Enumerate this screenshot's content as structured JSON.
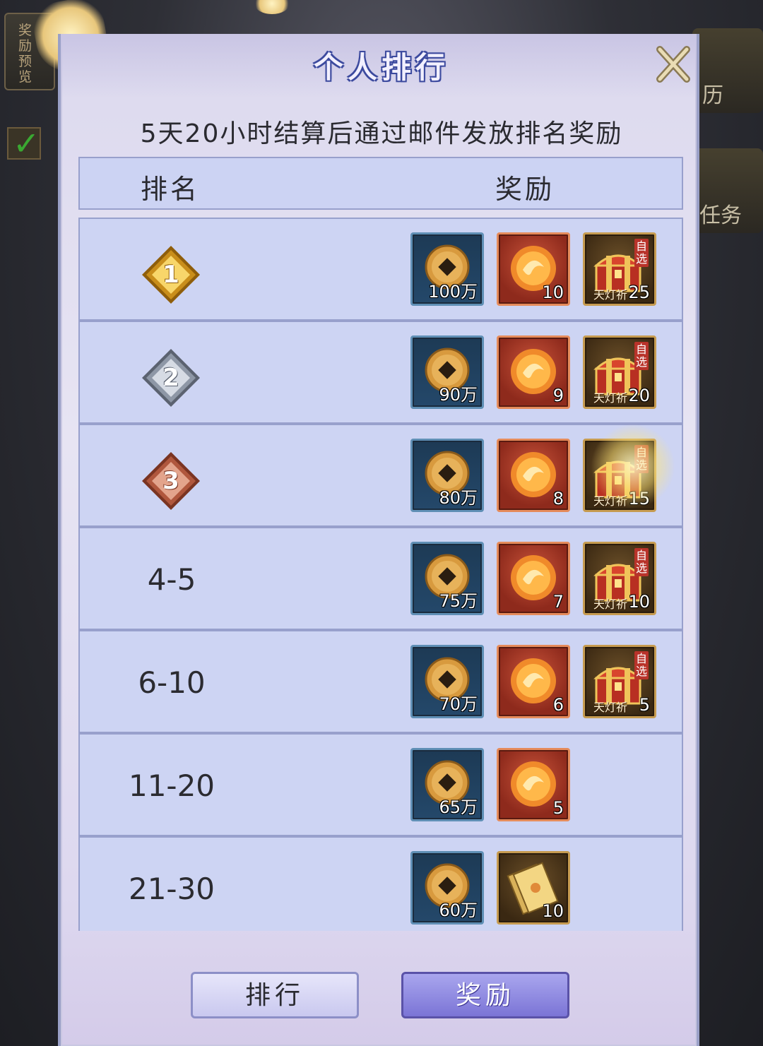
{
  "background": {
    "left_panel_label": "奖励预览",
    "right_label_1": "历",
    "right_label_2": "任务"
  },
  "dialog": {
    "title": "个人排行",
    "subtitle": "5天20小时结算后通过邮件发放排名奖励",
    "header": {
      "rank": "排名",
      "reward": "奖励"
    },
    "rows": [
      {
        "rank": "1",
        "medal": "gold",
        "rewards": [
          {
            "type": "coin",
            "qty": "100万"
          },
          {
            "type": "orb",
            "qty": "10"
          },
          {
            "type": "chest",
            "qty": "25",
            "tag": "天灯祈",
            "self_pick": "自选"
          }
        ]
      },
      {
        "rank": "2",
        "medal": "silver",
        "rewards": [
          {
            "type": "coin",
            "qty": "90万"
          },
          {
            "type": "orb",
            "qty": "9"
          },
          {
            "type": "chest",
            "qty": "20",
            "tag": "天灯祈",
            "self_pick": "自选"
          }
        ]
      },
      {
        "rank": "3",
        "medal": "bronze",
        "rewards": [
          {
            "type": "coin",
            "qty": "80万"
          },
          {
            "type": "orb",
            "qty": "8"
          },
          {
            "type": "chest",
            "qty": "15",
            "tag": "天灯祈",
            "self_pick": "自选"
          }
        ]
      },
      {
        "rank": "4-5",
        "rewards": [
          {
            "type": "coin",
            "qty": "75万"
          },
          {
            "type": "orb",
            "qty": "7"
          },
          {
            "type": "chest",
            "qty": "10",
            "tag": "天灯祈",
            "self_pick": "自选"
          }
        ]
      },
      {
        "rank": "6-10",
        "rewards": [
          {
            "type": "coin",
            "qty": "70万"
          },
          {
            "type": "orb",
            "qty": "6"
          },
          {
            "type": "chest",
            "qty": "5",
            "tag": "天灯祈",
            "self_pick": "自选"
          }
        ]
      },
      {
        "rank": "11-20",
        "rewards": [
          {
            "type": "coin",
            "qty": "65万"
          },
          {
            "type": "orb",
            "qty": "5"
          }
        ]
      },
      {
        "rank": "21-30",
        "rewards": [
          {
            "type": "coin",
            "qty": "60万"
          },
          {
            "type": "ticket",
            "qty": "10"
          }
        ]
      }
    ],
    "buttons": {
      "rank": "排行",
      "reward": "奖励"
    }
  },
  "colors": {
    "dialog_bg": "#e0ddf0",
    "row_bg": "#cdd4f3",
    "title_outline": "#3c4a9e",
    "active_button": "#8a84e0"
  }
}
